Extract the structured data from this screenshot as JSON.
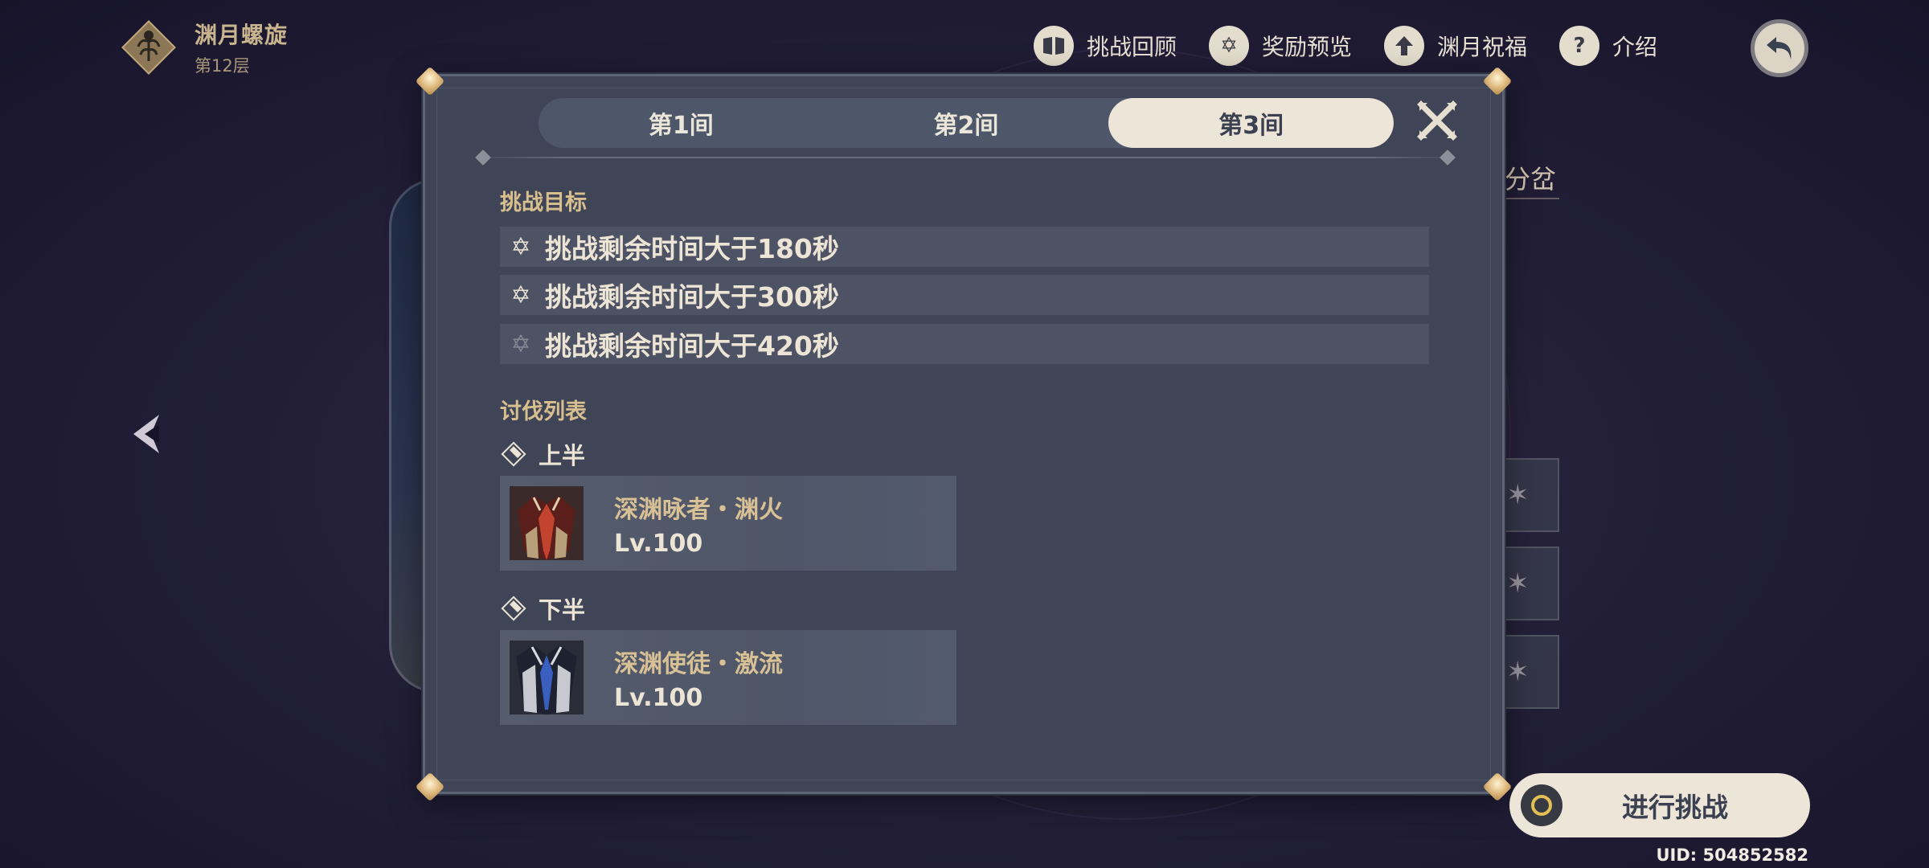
{
  "header": {
    "title": "渊月螺旋",
    "floor": "第12层"
  },
  "top_nav": [
    {
      "label": "挑战回顾",
      "icon": "book-icon"
    },
    {
      "label": "奖励预览",
      "icon": "star-badge-icon"
    },
    {
      "label": "渊月祝福",
      "icon": "up-arrow-icon"
    },
    {
      "label": "介绍",
      "icon": "question-icon"
    }
  ],
  "side": {
    "branch_label": "分岔"
  },
  "tabs": [
    {
      "label": "第1间",
      "active": false
    },
    {
      "label": "第2间",
      "active": false
    },
    {
      "label": "第3间",
      "active": true
    }
  ],
  "objectives": {
    "title": "挑战目标",
    "items": [
      {
        "text": "挑战剩余时间大于180秒",
        "achieved": true
      },
      {
        "text": "挑战剩余时间大于300秒",
        "achieved": true
      },
      {
        "text": "挑战剩余时间大于420秒",
        "achieved": false
      }
    ]
  },
  "enemies": {
    "title": "讨伐列表",
    "halves": [
      {
        "label": "上半",
        "enemy": {
          "name": "深渊咏者・渊火",
          "level": "Lv.100",
          "theme_color": "#c2442f"
        }
      },
      {
        "label": "下半",
        "enemy": {
          "name": "深渊使徒・激流",
          "level": "Lv.100",
          "theme_color": "#3b5fbf"
        }
      }
    ]
  },
  "start_button": {
    "label": "进行挑战"
  },
  "uid": "UID: 504852582",
  "colors": {
    "panel": "#3f4556",
    "accent_gold": "#d8bf8e",
    "tab_active": "#ece5d8"
  }
}
